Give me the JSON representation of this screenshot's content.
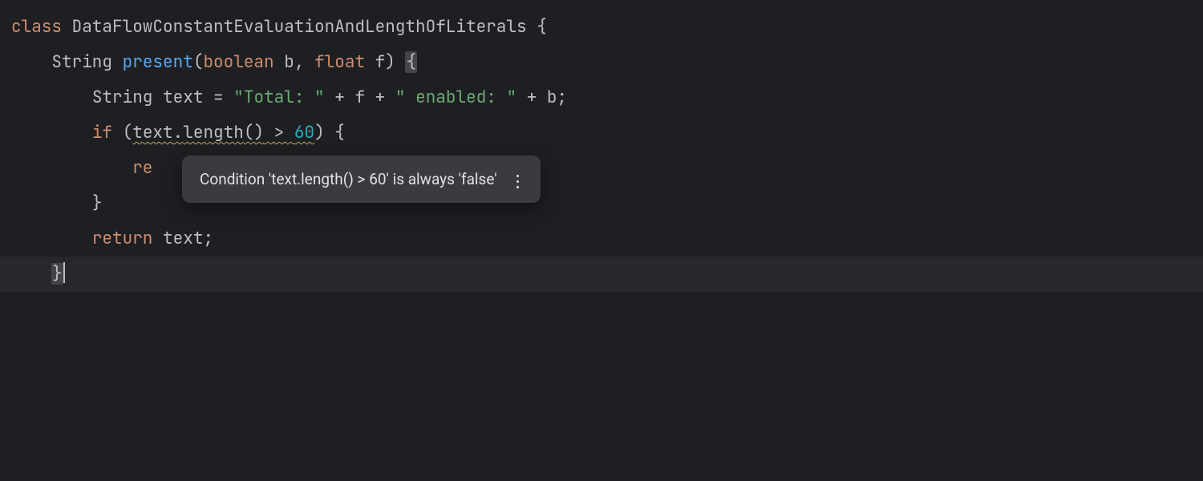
{
  "code": {
    "l1": {
      "kw_class": "class",
      "classname": "DataFlowConstantEvaluationAndLengthOfLiterals",
      "brace": "{"
    },
    "l2": {
      "indent": "    ",
      "ret": "String",
      "method": "present",
      "params": "(",
      "ptype1": "boolean",
      "p1": " b",
      "comma": ",",
      "sp": " ",
      "ptype2": "float",
      "p2": " f",
      "close": ")",
      "sp2": " ",
      "brace": "{"
    },
    "l3": {
      "indent": "        ",
      "type": "String",
      "var": " text ",
      "eq": "=",
      "sp": " ",
      "s1": "\"Total: \"",
      "plus1": " + ",
      "f": "f",
      "plus2": " + ",
      "s2": "\" enabled: \"",
      "plus3": " + ",
      "b": "b",
      "semi": ";"
    },
    "l4": {
      "indent": "        ",
      "kw_if": "if",
      "sp": " ",
      "open": "(",
      "expr_txt": "text",
      "dot": ".",
      "expr_len": "length",
      "parens": "()",
      "op": " > ",
      "num": "60",
      "close": ")",
      "sp2": " ",
      "brace": "{"
    },
    "l5": {
      "indent": "            ",
      "kw_return": "re"
    },
    "l6": {
      "indent": "        ",
      "brace": "}"
    },
    "l7": {
      "indent": "        ",
      "kw_return": "return",
      "sp": " ",
      "var": "text",
      "semi": ";"
    },
    "l8": {
      "indent": "    ",
      "brace": "}"
    }
  },
  "tooltip": {
    "message": "Condition 'text.length() > 60' is always 'false'"
  }
}
